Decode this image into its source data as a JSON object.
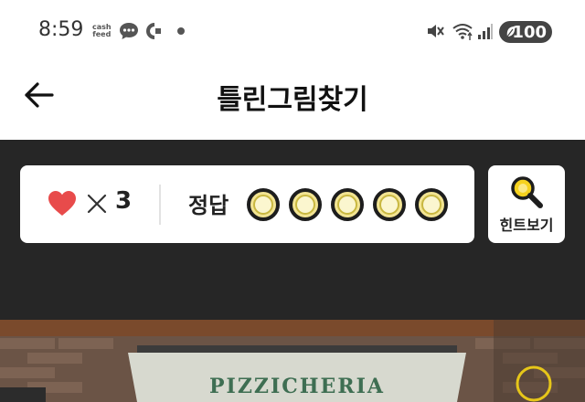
{
  "status_bar": {
    "time": "8:59",
    "cashfeed_line1": "cash",
    "cashfeed_line2": "feed",
    "battery": "100",
    "icons": [
      "chat-icon",
      "c-icon",
      "mute-icon",
      "wifi-icon",
      "signal-icon",
      "leaf-icon"
    ]
  },
  "app_bar": {
    "title": "틀린그림찾기",
    "back_icon": "arrow-left-icon"
  },
  "game": {
    "lives_icon": "heart-icon",
    "lives_multiplier": "×",
    "lives_count": "3",
    "answer_label": "정답",
    "answer_slots_total": 5,
    "answer_slots_found": 0,
    "hint_label": "힌트보기",
    "hint_icon": "magnifier-icon"
  },
  "puzzle": {
    "sign_text": "PIZZICHERIA",
    "colors": {
      "marker": "#e6c619",
      "awning": "#3e6e52"
    }
  },
  "colors": {
    "dark_background": "#262626",
    "heart": "#e84b4b",
    "slot_fill": "#f2e493"
  }
}
